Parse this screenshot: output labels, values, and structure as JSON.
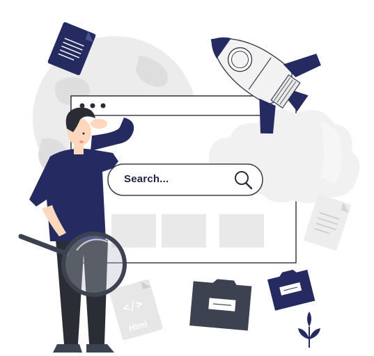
{
  "search": {
    "placeholder_text": "Search..."
  },
  "file_badge": {
    "label": "Html",
    "code_symbol": "</>"
  },
  "colors": {
    "navy": "#252a61",
    "light_gray": "#ebebeb",
    "mid_gray": "#cfcfcf",
    "dark_gray": "#3c4250",
    "skin": "#ffd7bd",
    "hair": "#2a2b35",
    "pants": "#2a2d33",
    "outline": "#2a2c3a"
  },
  "icons": [
    "globe-icon",
    "document-icon",
    "rocket-icon",
    "cloud-icon",
    "browser-window",
    "search-bar",
    "magnifier-icon",
    "person",
    "magnifying-glass",
    "html-file-icon",
    "folder-icon",
    "plant-icon"
  ]
}
